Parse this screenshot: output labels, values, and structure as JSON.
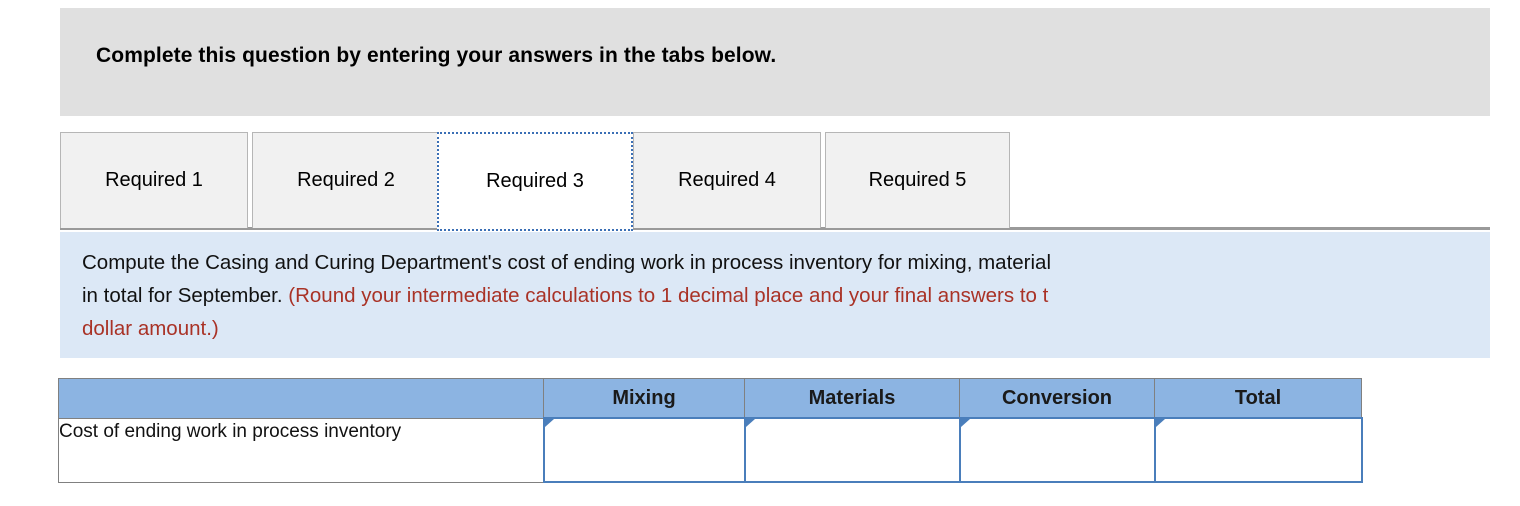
{
  "banner": {
    "text": "Complete this question by entering your answers in the tabs below."
  },
  "tabs": {
    "items": [
      {
        "label": "Required 1",
        "active": false
      },
      {
        "label": "Required 2",
        "active": false
      },
      {
        "label": "Required 3",
        "active": true
      },
      {
        "label": "Required 4",
        "active": false
      },
      {
        "label": "Required 5",
        "active": false
      }
    ]
  },
  "instructions": {
    "line1_black": "Compute the Casing and Curing Department's cost of ending work in process inventory for mixing, material",
    "line2_black": "in total for September. ",
    "line2_red": "(Round your intermediate calculations to 1 decimal place and your final answers to t",
    "line3_red": "dollar amount.)"
  },
  "table": {
    "headers": {
      "label": "",
      "mixing": "Mixing",
      "materials": "Materials",
      "conversion": "Conversion",
      "total": "Total"
    },
    "rows": [
      {
        "label": "Cost of ending work in process inventory",
        "mixing": "",
        "materials": "",
        "conversion": "",
        "total": ""
      }
    ]
  },
  "colors": {
    "banner_bg": "#e0e0e0",
    "info_bg": "#dce8f6",
    "info_red": "#a93226",
    "table_header_bg": "#8cb4e2",
    "input_border": "#4a7ebb",
    "focus_outline": "#3b6fb5"
  }
}
